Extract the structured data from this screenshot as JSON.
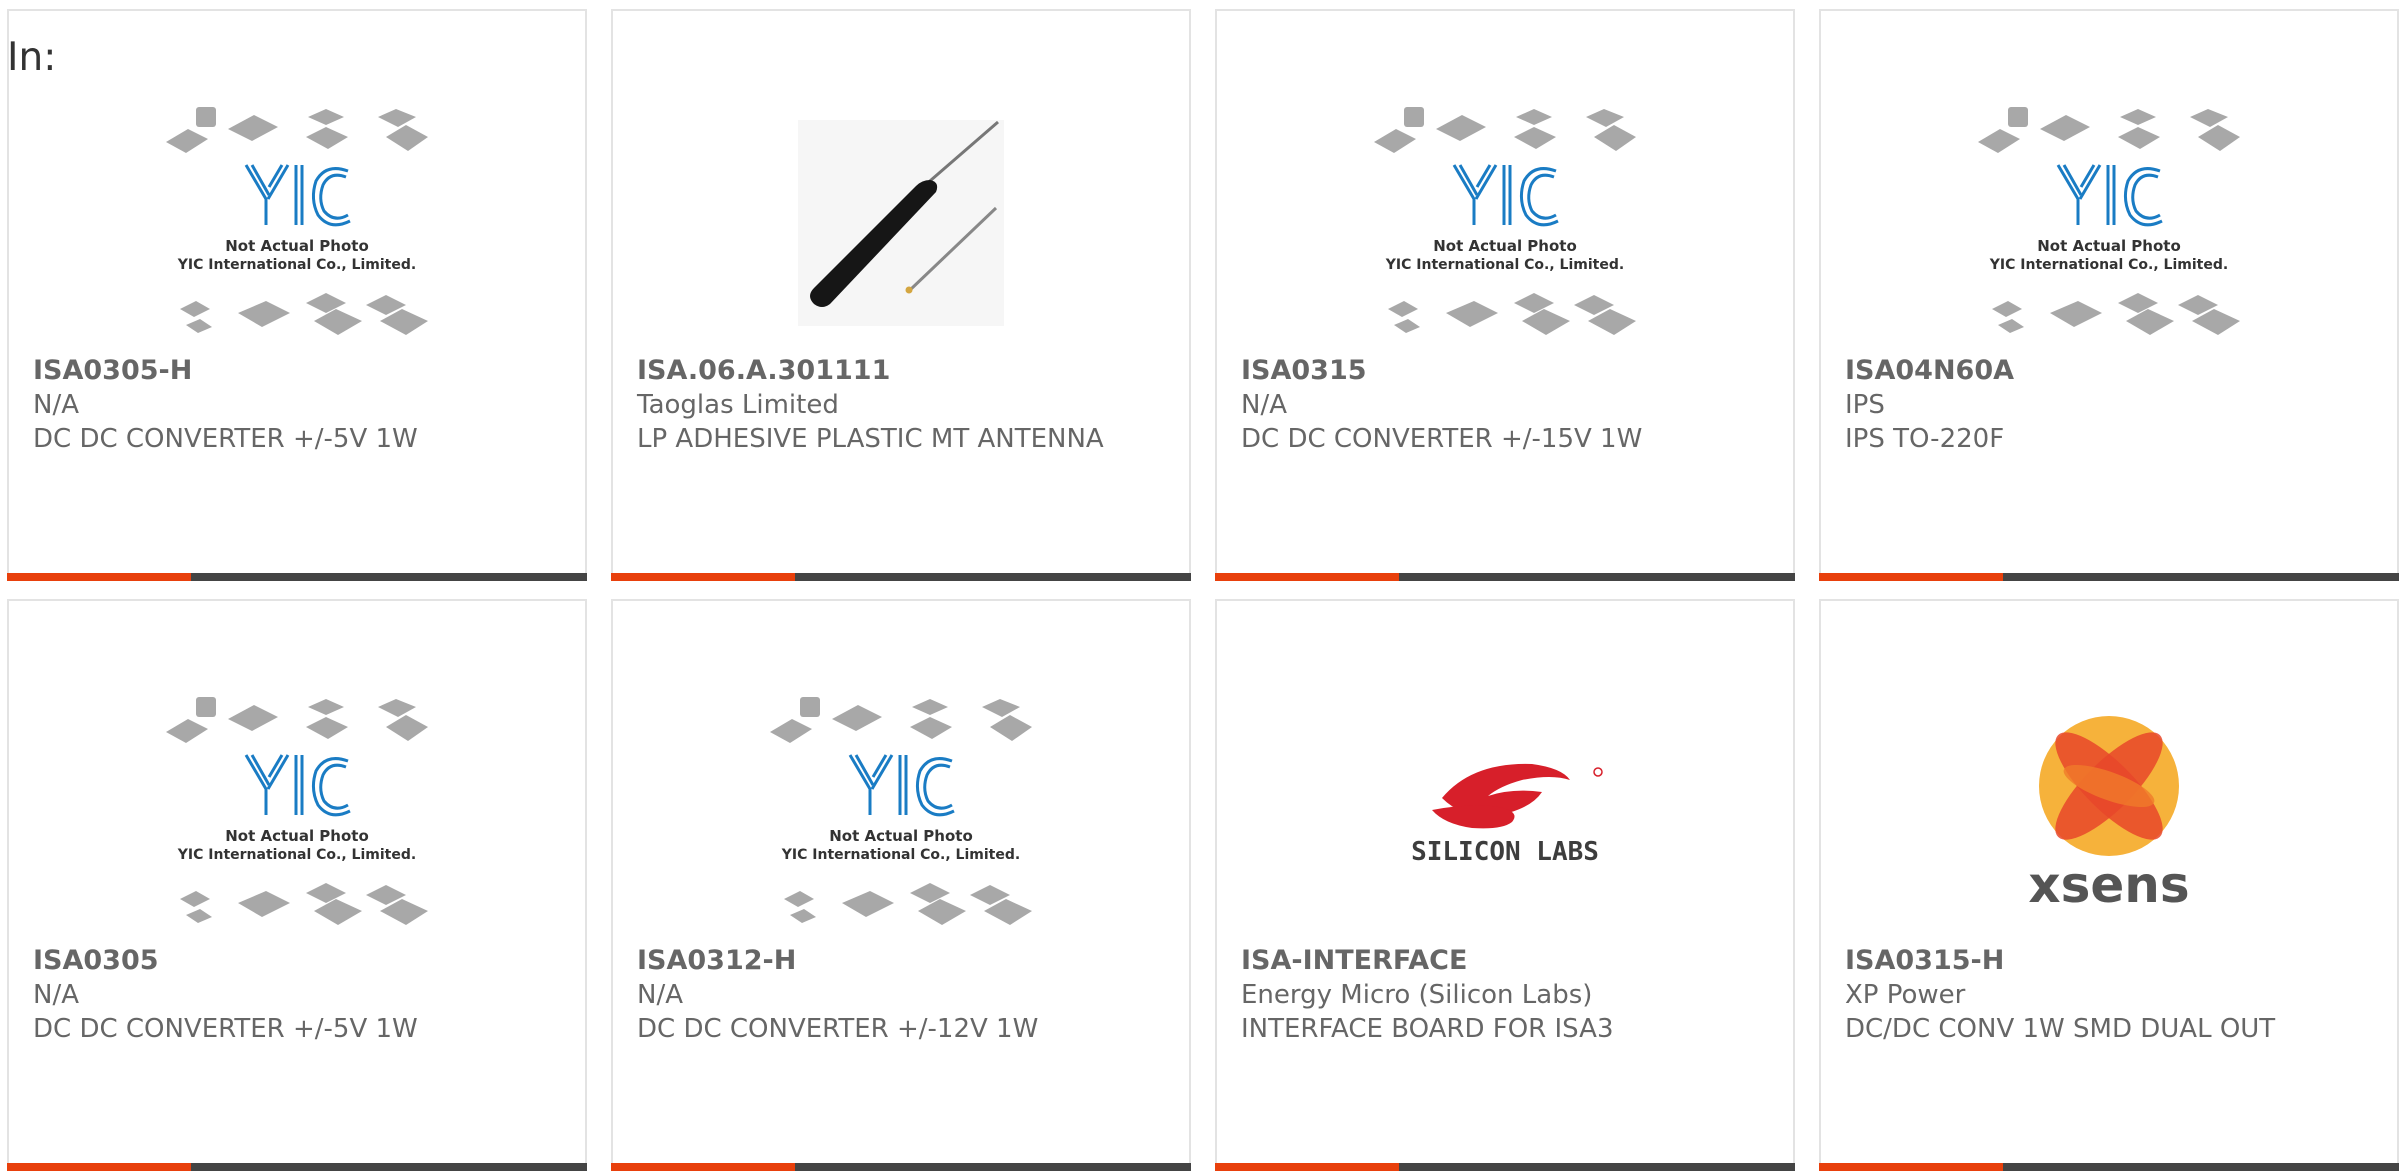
{
  "page": {
    "prefix_label": "In:"
  },
  "colors": {
    "accent": "#e8400c",
    "bar": "#444444",
    "text": "#666666",
    "yic_blue": "#1a7cc4"
  },
  "placeholder": {
    "caption_line1": "Not Actual Photo",
    "caption_line2": "YIC International Co., Limited.",
    "logo_text": "YIC"
  },
  "products": [
    {
      "part": "ISA0305-H",
      "maker": "N/A",
      "desc": "DC DC CONVERTER +/-5V 1W",
      "image": "yic-placeholder"
    },
    {
      "part": "ISA.06.A.301111",
      "maker": "Taoglas Limited",
      "desc": "LP ADHESIVE PLASTIC MT ANTENNA",
      "image": "antenna-photo"
    },
    {
      "part": "ISA0315",
      "maker": "N/A",
      "desc": "DC DC CONVERTER +/-15V 1W",
      "image": "yic-placeholder"
    },
    {
      "part": "ISA04N60A",
      "maker": "IPS",
      "desc": "IPS TO-220F",
      "image": "yic-placeholder"
    },
    {
      "part": "ISA0305",
      "maker": "N/A",
      "desc": "DC DC CONVERTER +/-5V 1W",
      "image": "yic-placeholder"
    },
    {
      "part": "ISA0312-H",
      "maker": "N/A",
      "desc": "DC DC CONVERTER +/-12V 1W",
      "image": "yic-placeholder"
    },
    {
      "part": "ISA-INTERFACE",
      "maker": "Energy Micro (Silicon Labs)",
      "desc": "INTERFACE BOARD FOR ISA3",
      "image": "silicon-labs-logo",
      "logo_text": "SILICON LABS"
    },
    {
      "part": "ISA0315-H",
      "maker": "XP Power",
      "desc": "DC/DC CONV 1W SMD DUAL OUT",
      "image": "xsens-logo",
      "logo_text": "xsens"
    }
  ]
}
